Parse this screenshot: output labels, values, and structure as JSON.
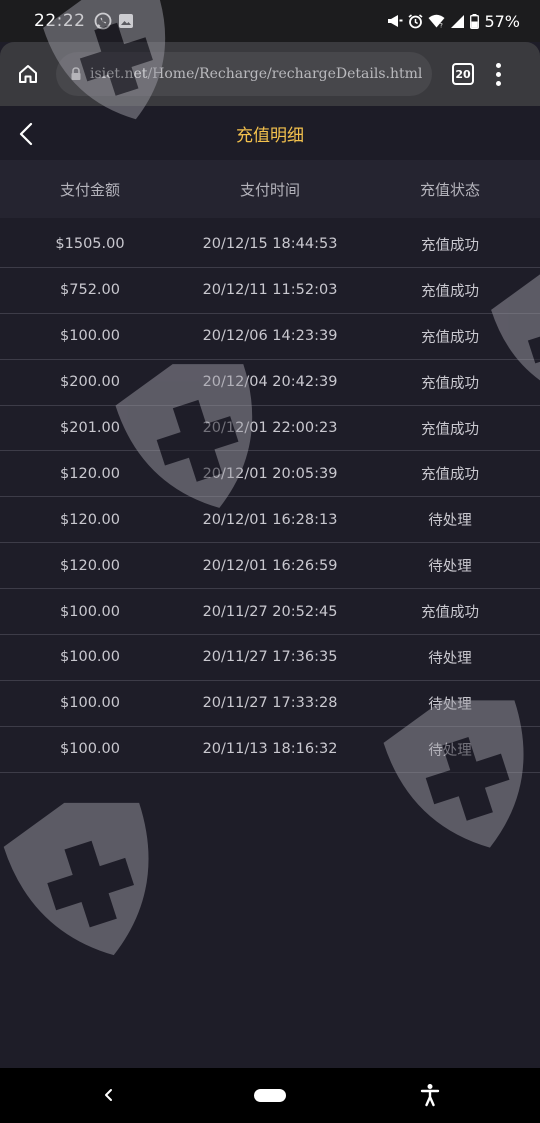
{
  "status_bar": {
    "time": "22:22",
    "battery": "57%",
    "icons_left": [
      "whatsapp-icon",
      "image-icon"
    ],
    "icons_right": [
      "megaphone-icon",
      "alarm-icon",
      "wifi-icon",
      "signal-icon",
      "battery-icon"
    ]
  },
  "browser": {
    "url_host": "isiet.net",
    "url_path": "/Home/Recharge/rechargeDetails.html",
    "tab_count": "20"
  },
  "header": {
    "title": "充值明细"
  },
  "table": {
    "columns": [
      "支付金额",
      "支付时间",
      "充值状态"
    ],
    "rows": [
      [
        "$1505.00",
        "20/12/15 18:44:53",
        "充值成功"
      ],
      [
        "$752.00",
        "20/12/11 11:52:03",
        "充值成功"
      ],
      [
        "$100.00",
        "20/12/06 14:23:39",
        "充值成功"
      ],
      [
        "$200.00",
        "20/12/04 20:42:39",
        "充值成功"
      ],
      [
        "$201.00",
        "20/12/01 22:00:23",
        "充值成功"
      ],
      [
        "$120.00",
        "20/12/01 20:05:39",
        "充值成功"
      ],
      [
        "$120.00",
        "20/12/01 16:28:13",
        "待处理"
      ],
      [
        "$120.00",
        "20/12/01 16:26:59",
        "待处理"
      ],
      [
        "$100.00",
        "20/11/27 20:52:45",
        "充值成功"
      ],
      [
        "$100.00",
        "20/11/27 17:36:35",
        "待处理"
      ],
      [
        "$100.00",
        "20/11/27 17:33:28",
        "待处理"
      ],
      [
        "$100.00",
        "20/11/13 18:16:32",
        "待处理"
      ]
    ]
  },
  "colors": {
    "accent": "#f3c14d",
    "background": "#1e1d28",
    "header_row": "#252430"
  }
}
